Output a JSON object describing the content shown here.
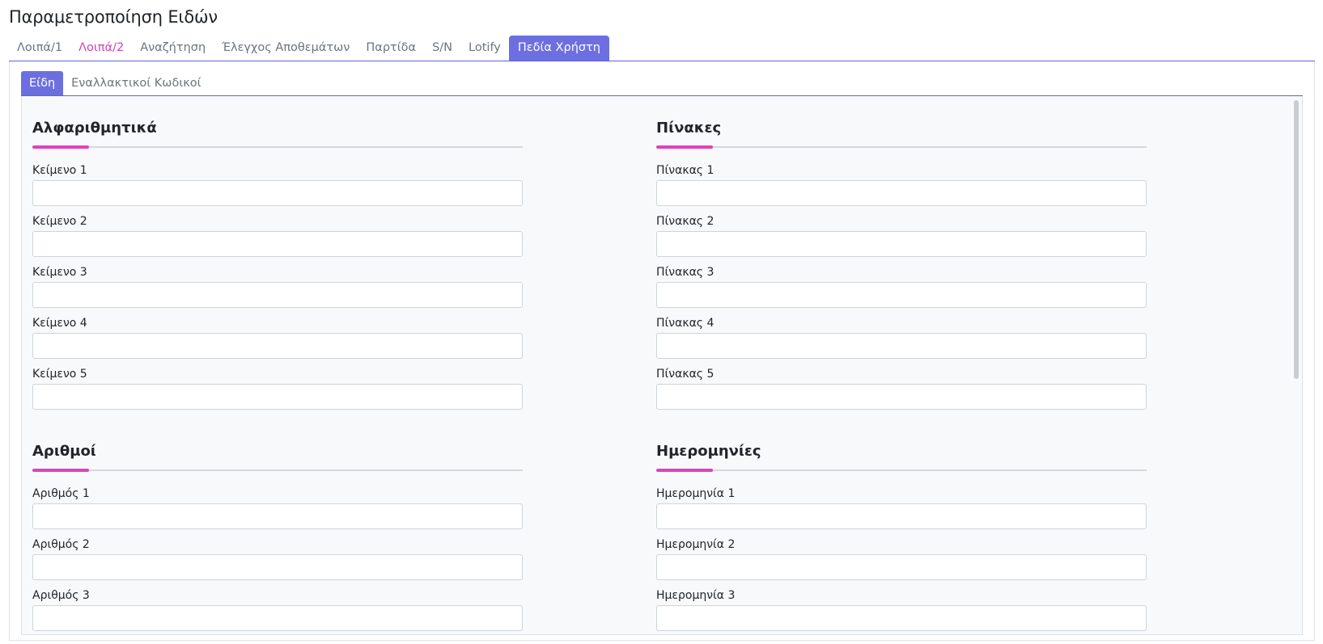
{
  "page": {
    "title": "Παραμετροποίηση Ειδών"
  },
  "top_tabs": [
    {
      "label": "Λοιπά/1",
      "state": "normal"
    },
    {
      "label": "Λοιπά/2",
      "state": "magenta"
    },
    {
      "label": "Αναζήτηση",
      "state": "normal"
    },
    {
      "label": "Έλεγχος Αποθεμάτων",
      "state": "normal"
    },
    {
      "label": "Παρτίδα",
      "state": "normal"
    },
    {
      "label": "S/N",
      "state": "normal"
    },
    {
      "label": "Lotify",
      "state": "normal"
    },
    {
      "label": "Πεδία Χρήστη",
      "state": "active"
    }
  ],
  "sub_tabs": [
    {
      "label": "Είδη",
      "state": "active"
    },
    {
      "label": "Εναλλακτικοί Κωδικοί",
      "state": "normal"
    }
  ],
  "sections": {
    "alphanumeric": {
      "title": "Αλφαριθμητικά",
      "fields": [
        {
          "label": "Κείμενο 1",
          "value": ""
        },
        {
          "label": "Κείμενο 2",
          "value": ""
        },
        {
          "label": "Κείμενο 3",
          "value": ""
        },
        {
          "label": "Κείμενο 4",
          "value": ""
        },
        {
          "label": "Κείμενο 5",
          "value": ""
        }
      ]
    },
    "tables": {
      "title": "Πίνακες",
      "fields": [
        {
          "label": "Πίνακας 1",
          "value": ""
        },
        {
          "label": "Πίνακας 2",
          "value": ""
        },
        {
          "label": "Πίνακας 3",
          "value": ""
        },
        {
          "label": "Πίνακας 4",
          "value": ""
        },
        {
          "label": "Πίνακας 5",
          "value": ""
        }
      ]
    },
    "numbers": {
      "title": "Αριθμοί",
      "fields": [
        {
          "label": "Αριθμός 1",
          "value": ""
        },
        {
          "label": "Αριθμός 2",
          "value": ""
        },
        {
          "label": "Αριθμός 3",
          "value": ""
        }
      ]
    },
    "dates": {
      "title": "Ημερομηνίες",
      "fields": [
        {
          "label": "Ημερομηνία 1",
          "value": ""
        },
        {
          "label": "Ημερομηνία 2",
          "value": ""
        },
        {
          "label": "Ημερομηνία 3",
          "value": ""
        }
      ]
    }
  },
  "colors": {
    "accent": "#6d6fe0",
    "highlight": "#e040c0"
  }
}
